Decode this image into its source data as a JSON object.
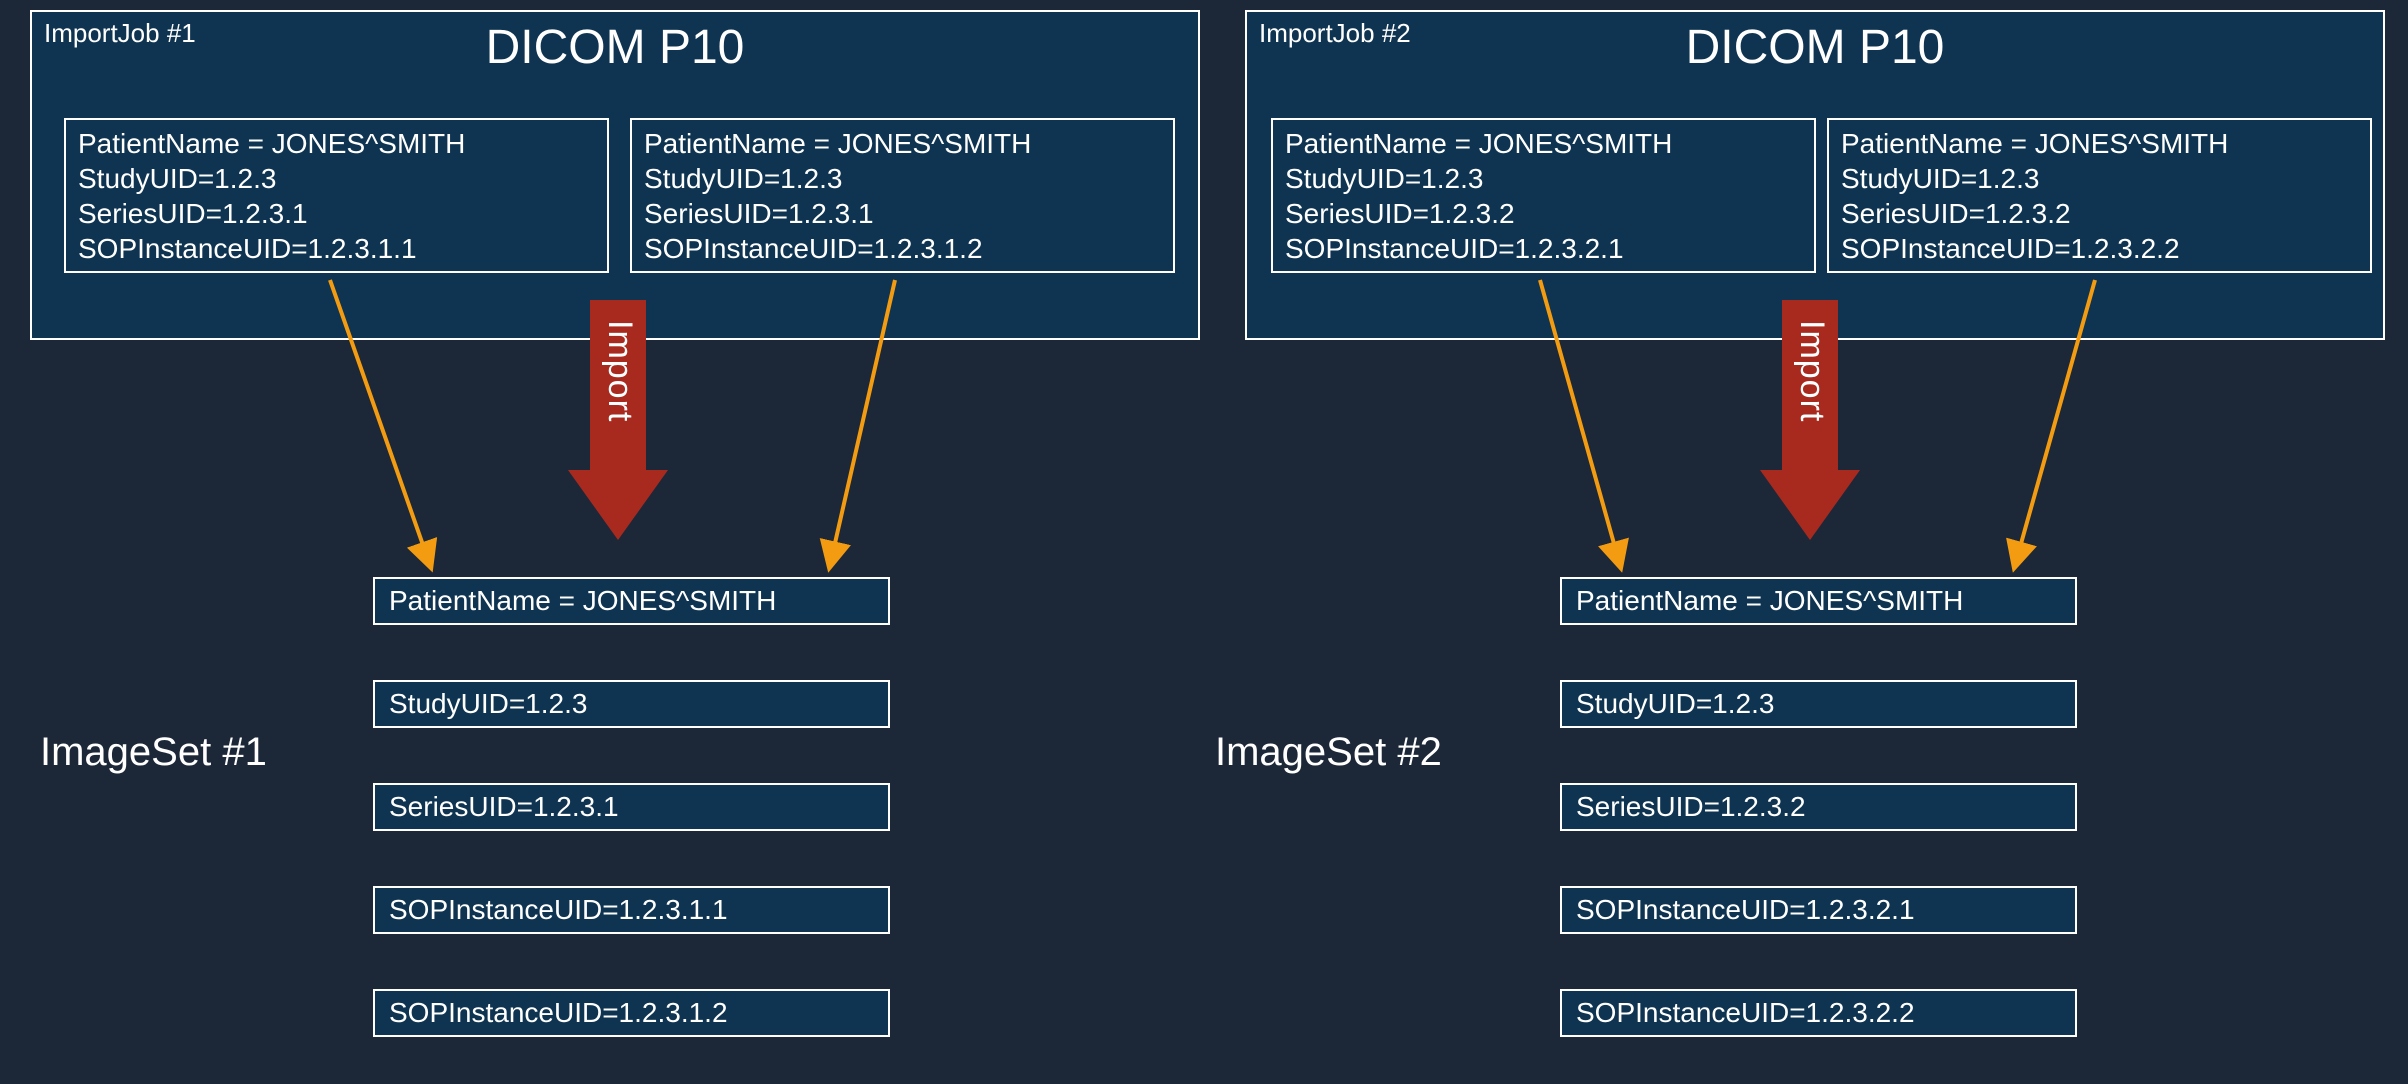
{
  "job1": {
    "label": "ImportJob #1",
    "title": "DICOM P10",
    "left": {
      "l1": "PatientName = JONES^SMITH",
      "l2": "StudyUID=1.2.3",
      "l3": "SeriesUID=1.2.3.1",
      "l4": "SOPInstanceUID=1.2.3.1.1"
    },
    "right": {
      "l1": "PatientName = JONES^SMITH",
      "l2": "StudyUID=1.2.3",
      "l3": "SeriesUID=1.2.3.1",
      "l4": "SOPInstanceUID=1.2.3.1.2"
    },
    "importLabel": "Import"
  },
  "job2": {
    "label": "ImportJob #2",
    "title": "DICOM P10",
    "left": {
      "l1": "PatientName = JONES^SMITH",
      "l2": "StudyUID=1.2.3",
      "l3": "SeriesUID=1.2.3.2",
      "l4": "SOPInstanceUID=1.2.3.2.1"
    },
    "right": {
      "l1": "PatientName = JONES^SMITH",
      "l2": "StudyUID=1.2.3",
      "l3": "SeriesUID=1.2.3.2",
      "l4": "SOPInstanceUID=1.2.3.2.2"
    },
    "importLabel": "Import"
  },
  "imageset1": {
    "label": "ImageSet #1",
    "r1": "PatientName = JONES^SMITH",
    "r2": "StudyUID=1.2.3",
    "r3": "SeriesUID=1.2.3.1",
    "r4": "SOPInstanceUID=1.2.3.1.1",
    "r5": "SOPInstanceUID=1.2.3.1.2"
  },
  "imageset2": {
    "label": "ImageSet #2",
    "r1": "PatientName = JONES^SMITH",
    "r2": "StudyUID=1.2.3",
    "r3": "SeriesUID=1.2.3.2",
    "r4": "SOPInstanceUID=1.2.3.2.1",
    "r5": "SOPInstanceUID=1.2.3.2.2"
  }
}
